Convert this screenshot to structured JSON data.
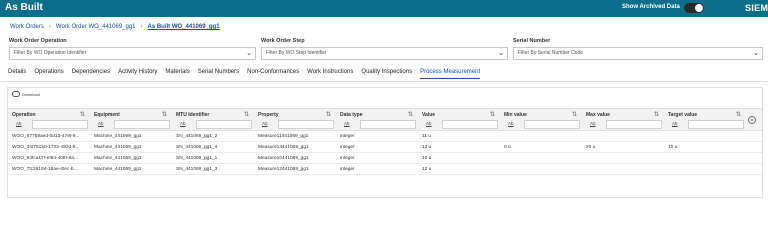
{
  "topbar": {
    "title": "As Built",
    "show_archived_label": "Show Archived Data",
    "brand": "SIEM"
  },
  "breadcrumb": [
    "Work Orders",
    "Work Order WO_441069_gg1",
    "As Built WO_441069_gg1"
  ],
  "filters": [
    {
      "label": "Work Order Operation",
      "placeholder": "Filter By WO Operation Identifier"
    },
    {
      "label": "Work Order Step",
      "placeholder": "Filter By WO Step Identifier"
    },
    {
      "label": "Serial Number",
      "placeholder": "Filter By Serial Number Code"
    }
  ],
  "tabs": [
    "Details",
    "Operations",
    "Dependencies",
    "Activity History",
    "Materials",
    "Serial Numbers",
    "Non-Conformances",
    "Work Instructions",
    "Quality Inspections",
    "Process Measurement"
  ],
  "active_tab": "Process Measurement",
  "toolbar": {
    "download_label": "Download"
  },
  "grid": {
    "columns": [
      "Operation",
      "Equipment",
      "MTU Identifier",
      "Property",
      "Data type",
      "Value",
      "Min value",
      "Max value",
      "Target value"
    ],
    "filter_button_label": "Ab",
    "rows": [
      [
        "WOO_67758aed-0d13-478f-9...",
        "Machine_441069_gg1",
        "SN_441069_gg1_2",
        "Measure11441069_gg1",
        "integer",
        "11 u",
        "",
        "",
        ""
      ],
      [
        "WOO_34f75150-1703-492d-8...",
        "Machine_441069_gg1",
        "SN_441069_gg1_4",
        "Measure13441069_gg1",
        "integer",
        "13 u",
        "0 u",
        "20 u",
        "10 u"
      ],
      [
        "WOO_94fca17f-ef84-408f-8a...",
        "Machine_441069_gg1",
        "SN_441069_gg1_1",
        "Measure10441069_gg1",
        "integer",
        "10 u",
        "",
        "",
        ""
      ],
      [
        "WOO_7fc26194-16ae-4fec-b...",
        "Machine_441069_gg1",
        "SN_441069_gg1_3",
        "Measure12441069_gg1",
        "integer",
        "12 u",
        "",
        "",
        ""
      ]
    ]
  },
  "icons": {
    "download": "cloud-download-icon",
    "sort": "sort-icon",
    "settings": "gear-icon",
    "dropdown": "chevron-down-icon"
  },
  "colors": {
    "header_bg": "#0b6e8a",
    "link": "#1b4f9c"
  }
}
